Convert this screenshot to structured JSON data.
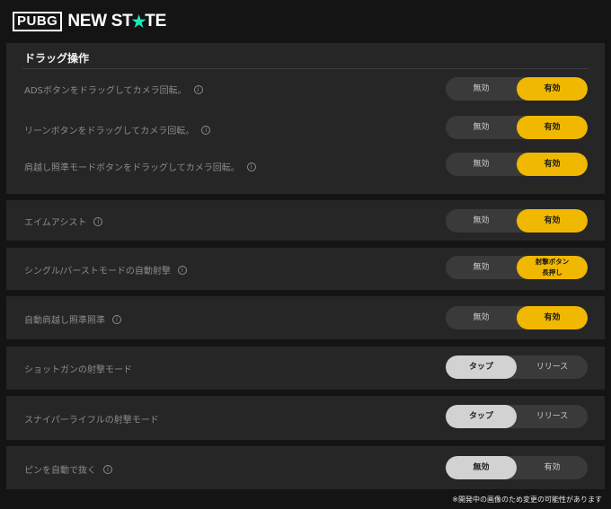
{
  "brand": {
    "logo_box": "PUBG",
    "logo_new": "NEW ST",
    "logo_star": "★",
    "logo_e": "TE"
  },
  "drag_section": {
    "title": "ドラッグ操作",
    "rows": [
      {
        "label": "ADSボタンをドラッグしてカメラ回転。",
        "options": [
          "無効",
          "有効"
        ],
        "selected": 1
      },
      {
        "label": "リーンボタンをドラッグしてカメラ回転。",
        "options": [
          "無効",
          "有効"
        ],
        "selected": 1
      },
      {
        "label": "肩越し照準モードボタンをドラッグしてカメラ回転。",
        "options": [
          "無効",
          "有効"
        ],
        "selected": 1
      }
    ]
  },
  "settings": [
    {
      "label": "エイムアシスト",
      "info": true,
      "options": [
        "無効",
        "有効"
      ],
      "selected": 1
    },
    {
      "label": "シングル/バーストモードの自動射撃",
      "info": true,
      "options": [
        "無効",
        "射撃ボタン\n長押し"
      ],
      "selected": 1
    },
    {
      "label": "自動肩越し照準照準",
      "info": true,
      "options": [
        "無効",
        "有効"
      ],
      "selected": 1
    },
    {
      "label": "ショットガンの射撃モード",
      "info": false,
      "options": [
        "タップ",
        "リリース"
      ],
      "selected": 0
    },
    {
      "label": "スナイパーライフルの射撃モード",
      "info": false,
      "options": [
        "タップ",
        "リリース"
      ],
      "selected": 0
    },
    {
      "label": "ピンを自動で抜く",
      "info": true,
      "options": [
        "無効",
        "有効"
      ],
      "selected": 0
    }
  ],
  "info_glyph": "i",
  "footnote": "※開発中の画像のため変更の可能性があります",
  "colors": {
    "accent_yellow": "#f0b800",
    "selected_gray": "#d2d2d2",
    "panel": "#262626",
    "background": "#141414"
  }
}
